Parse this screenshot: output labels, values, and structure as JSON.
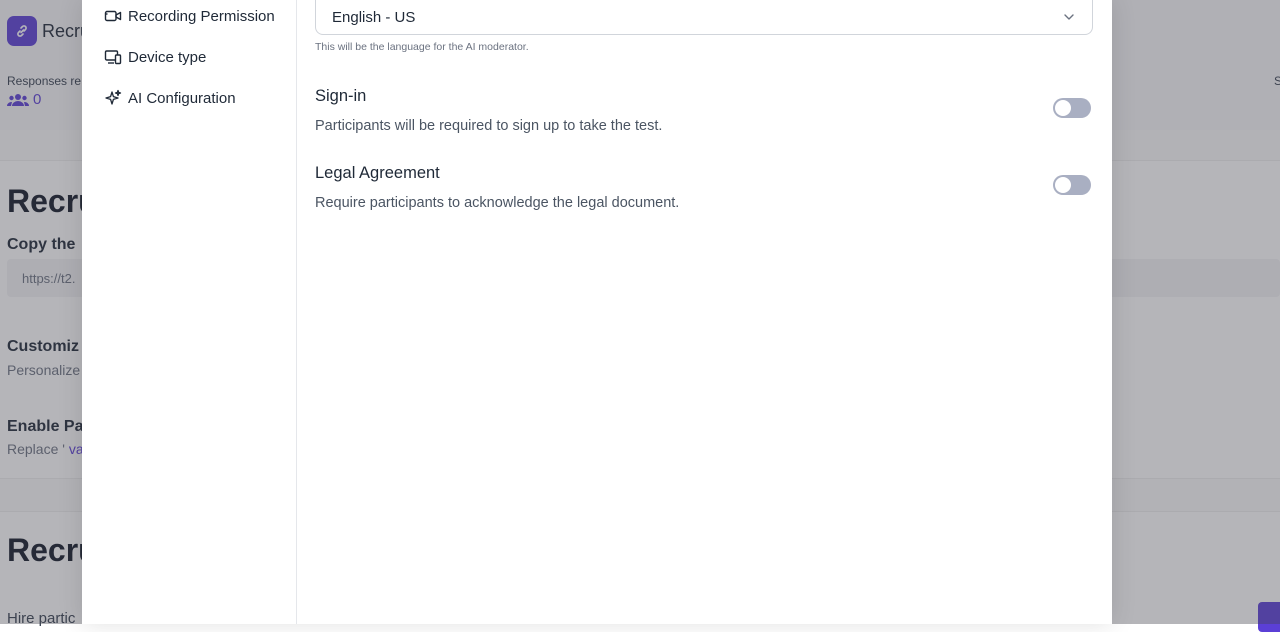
{
  "background": {
    "app_title": "Recru",
    "responses_label": "Responses re",
    "responses_count": "0",
    "right_edge_label": "S",
    "section_title_1": "Recru",
    "copy_label": "Copy the",
    "url_text": "https://t2.",
    "customize_title": "Customiz",
    "personalize_text": "Personalize",
    "enable_title": "Enable Pa",
    "replace_prefix": "Replace '",
    "replace_var": "va",
    "section_title_2": "Recru",
    "hire_text": "Hire partic"
  },
  "sidebar": {
    "items": [
      {
        "label": "Recording Permission",
        "icon": "video-camera-icon"
      },
      {
        "label": "Device type",
        "icon": "devices-icon"
      },
      {
        "label": "AI Configuration",
        "icon": "sparkle-icon"
      }
    ]
  },
  "language": {
    "selected": "English - US",
    "helper": "This will be the language for the AI moderator."
  },
  "settings": {
    "sign_in": {
      "title": "Sign-in",
      "description": "Participants will be required to sign up to take the test.",
      "enabled": false
    },
    "legal_agreement": {
      "title": "Legal Agreement",
      "description": "Require participants to acknowledge the legal document.",
      "enabled": false
    }
  },
  "colors": {
    "accent": "#5b3fd6",
    "toggle_off": "#a9afc2",
    "overlay": "rgba(70,70,80,0.40)"
  }
}
